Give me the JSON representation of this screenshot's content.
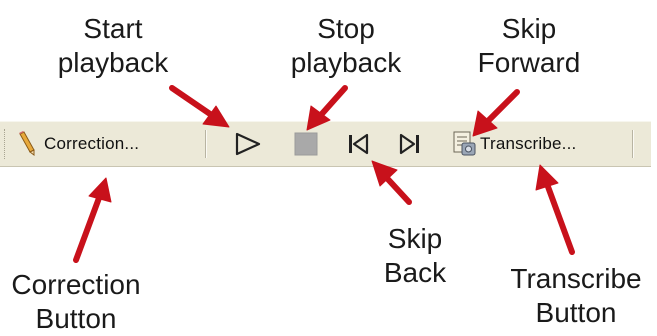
{
  "callouts": {
    "start": [
      "Start",
      "playback"
    ],
    "stop": [
      "Stop",
      "playback"
    ],
    "skip_forward": [
      "Skip",
      "Forward"
    ],
    "skip_back": [
      "Skip",
      "Back"
    ],
    "correction": [
      "Correction",
      "Button"
    ],
    "transcribe": [
      "Transcribe",
      "Button"
    ]
  },
  "toolbar": {
    "correction_label": "Correction...",
    "transcribe_label": "Transcribe...",
    "icons": {
      "correction": "pencil-icon",
      "play": "play-icon",
      "stop": "stop-icon",
      "skip_back": "skip-back-icon",
      "skip_forward": "skip-forward-icon",
      "transcribe": "transcribe-document-icon"
    }
  },
  "colors": {
    "toolbar_bg": "#ece9d8",
    "arrow": "#c8111b",
    "stop_fill": "#a9a9a9"
  }
}
